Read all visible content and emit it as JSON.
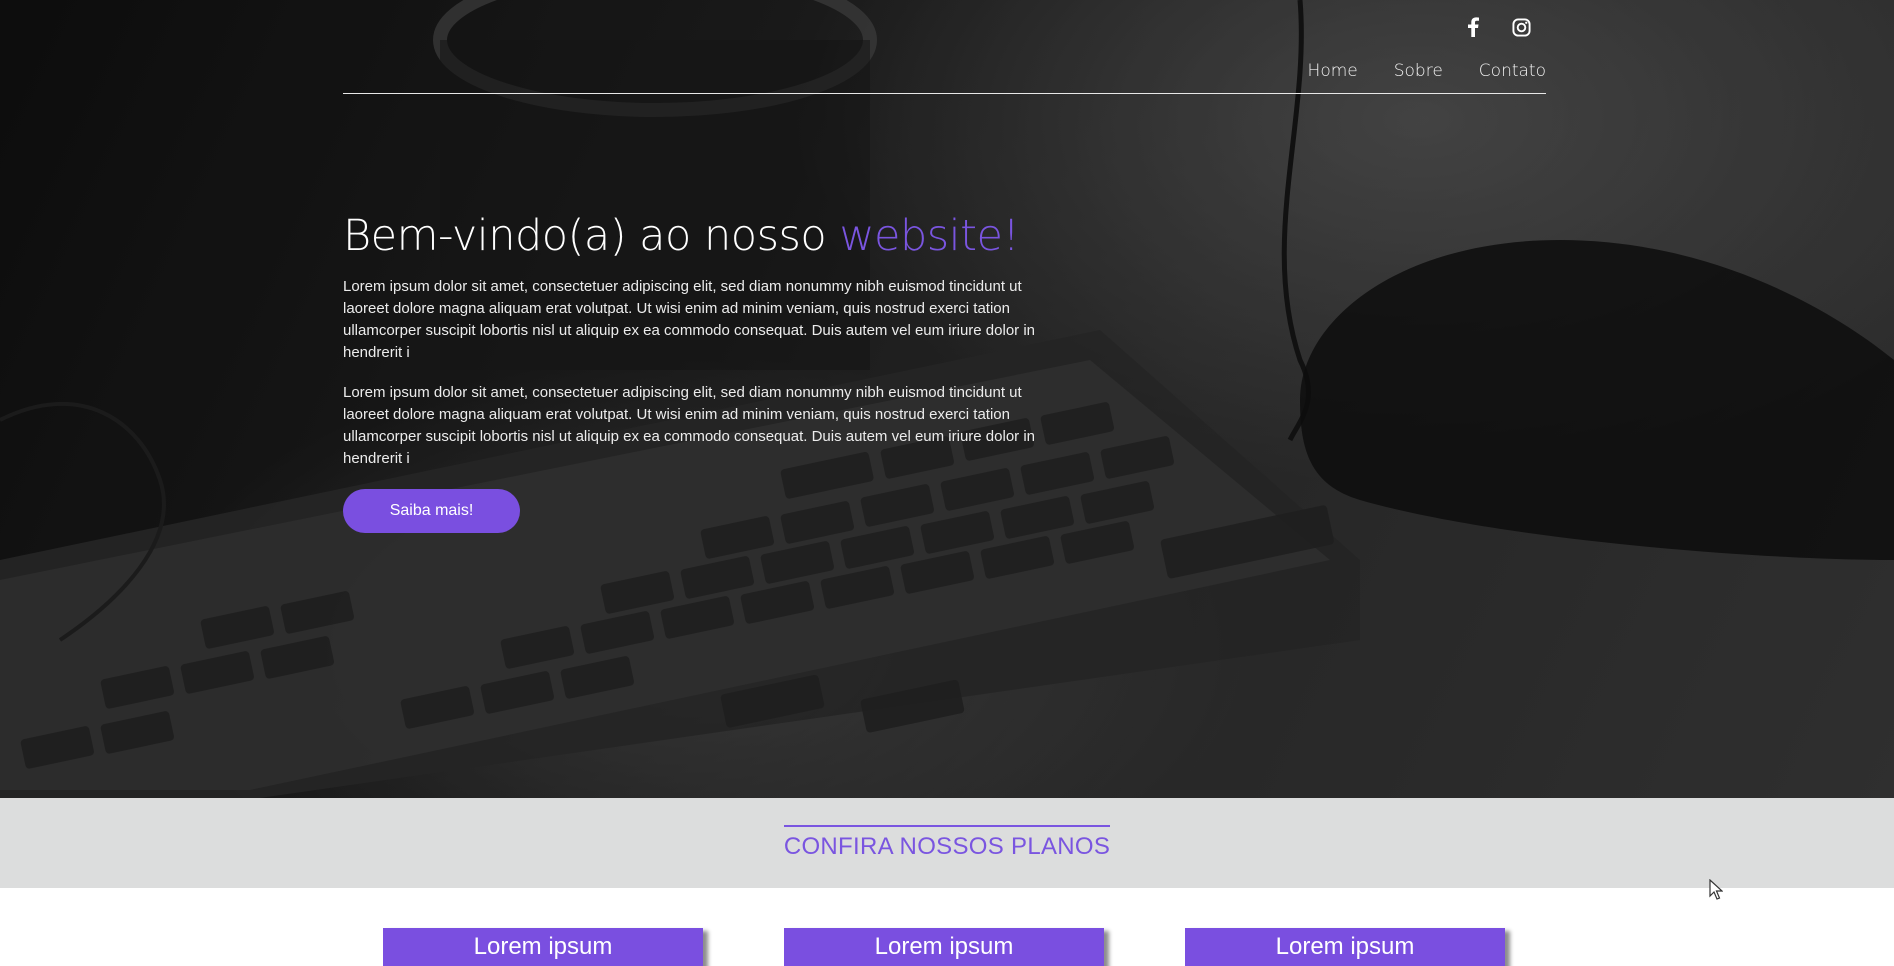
{
  "header": {
    "social": [
      {
        "icon": "facebook-icon"
      },
      {
        "icon": "instagram-icon"
      }
    ],
    "nav": [
      {
        "label": "Home"
      },
      {
        "label": "Sobre"
      },
      {
        "label": "Contato"
      }
    ]
  },
  "hero": {
    "title_main": "Bem-vindo(a) ao nosso",
    "title_accent": "website!",
    "paragraphs": [
      "Lorem ipsum dolor sit amet, consectetuer adipiscing elit, sed diam nonummy nibh euismod tincidunt ut laoreet dolore magna aliquam erat volutpat. Ut wisi enim ad minim veniam, quis nostrud exerci tation ullamcorper suscipit lobortis nisl ut aliquip ex ea commodo consequat. Duis autem vel eum iriure dolor in hendrerit i",
      "Lorem ipsum dolor sit amet, consectetuer adipiscing elit, sed diam nonummy nibh euismod tincidunt ut laoreet dolore magna aliquam erat volutpat. Ut wisi enim ad minim veniam, quis nostrud exerci tation ullamcorper suscipit lobortis nisl ut aliquip ex ea commodo consequat. Duis autem vel eum iriure dolor in hendrerit i"
    ],
    "cta_label": "Saiba mais!"
  },
  "plans": {
    "title": "CONFIRA NOSSOS PLANOS",
    "cards": [
      {
        "title": "Lorem ipsum"
      },
      {
        "title": "Lorem ipsum"
      },
      {
        "title": "Lorem ipsum"
      }
    ]
  },
  "colors": {
    "accent": "#7a4fe0",
    "band": "#dcdddd"
  }
}
